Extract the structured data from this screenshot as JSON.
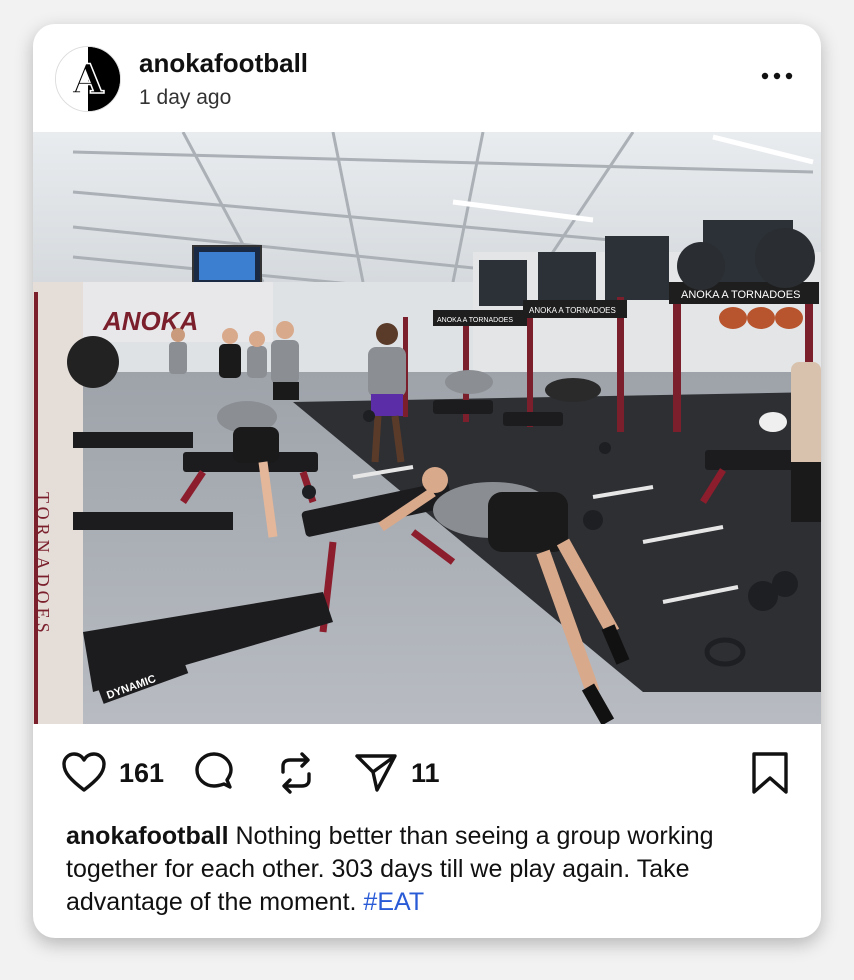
{
  "post": {
    "username": "anokafootball",
    "time": "1 day ago",
    "avatar_letter": "A",
    "photo": {
      "banner_text": "ANOKA",
      "rack_sign_1": "ANOKA A TORNADOES",
      "rack_sign_2": "ANOKA A TORNADOES",
      "rack_sign_3": "ANOKA A TORNADOES",
      "pillar_text": "TORNADOES",
      "bench_brand": "DYNAMIC"
    },
    "likes": "161",
    "shares": "11",
    "caption": {
      "user": "anokafootball",
      "text": "Nothing better than seeing a group working together for each other. 303 days till we play again. Take advantage of the moment.",
      "hashtag": "#EAT"
    }
  },
  "colors": {
    "accent": "#7a1f2b",
    "hashtag": "#2a5bd7"
  },
  "icons": {
    "like": "heart-icon",
    "comment": "comment-icon",
    "repost": "repost-icon",
    "share": "send-icon",
    "save": "bookmark-icon",
    "more": "more-dots-icon"
  }
}
